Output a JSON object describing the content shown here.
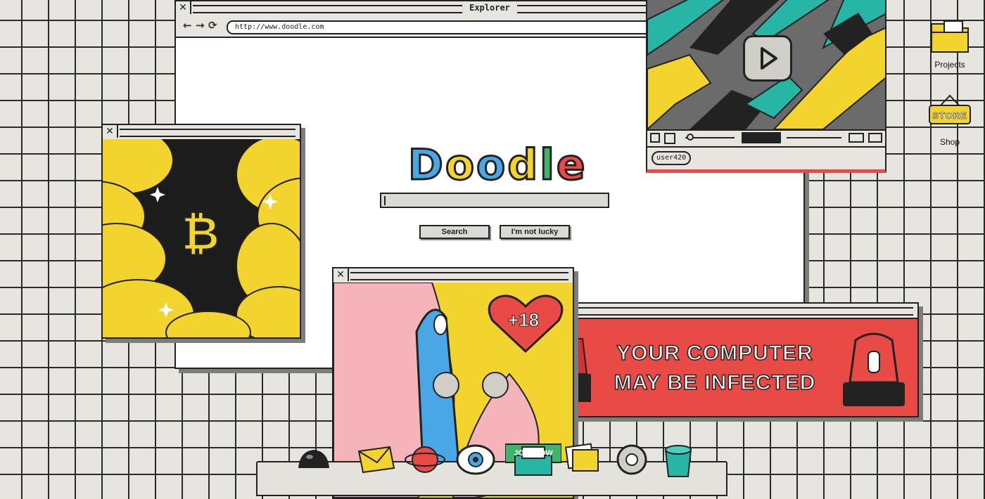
{
  "browser": {
    "title": "Explorer",
    "close_glyph": "✕",
    "nav": {
      "back": "←",
      "forward": "→",
      "reload": "⟳"
    },
    "url": "http://www.doodle.com",
    "logo_letters": [
      {
        "ch": "D",
        "color": "#4aa7e6"
      },
      {
        "ch": "o",
        "color": "#f3d32e"
      },
      {
        "ch": "o",
        "color": "#4aa7e6"
      },
      {
        "ch": "d",
        "color": "#f3d32e"
      },
      {
        "ch": "l",
        "color": "#3fb56b"
      },
      {
        "ch": "e",
        "color": "#e84a45"
      }
    ],
    "search_label": "Search",
    "lucky_label": "I'm not lucky"
  },
  "video": {
    "user": "user420",
    "close_glyph": "✕"
  },
  "btc": {
    "close_glyph": "✕",
    "symbol": "₿"
  },
  "adult": {
    "close_glyph": "✕",
    "badge": "+18",
    "button_text": "JOIN NOW"
  },
  "alert": {
    "line1": "YOUR COMPUTER",
    "line2": "MAY BE INFECTED"
  },
  "desktop": {
    "projects_label": "Projects",
    "shop_label": "Shop",
    "store_sign": "STORE"
  },
  "dock": {
    "items": [
      "mouse-icon",
      "mail-icon",
      "planet-icon",
      "eye-icon",
      "printer-icon",
      "photos-icon",
      "settings-icon",
      "trash-icon"
    ]
  },
  "colors": {
    "accent_red": "#e84a45",
    "yellow": "#f3d32e",
    "blue": "#4aa7e6",
    "teal": "#27b6a6",
    "pink": "#f4b4b9"
  }
}
